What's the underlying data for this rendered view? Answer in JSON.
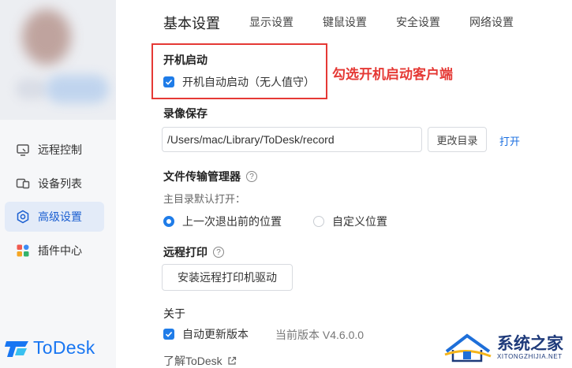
{
  "sidebar": {
    "items": [
      {
        "label": "远程控制",
        "icon": "monitor-icon",
        "active": false
      },
      {
        "label": "设备列表",
        "icon": "devices-icon",
        "active": false
      },
      {
        "label": "高级设置",
        "icon": "advanced-settings-icon",
        "active": true
      },
      {
        "label": "插件中心",
        "icon": "plugins-icon",
        "active": false
      }
    ],
    "logo_text": "ToDesk"
  },
  "tabs": [
    {
      "label": "基本设置",
      "active": true
    },
    {
      "label": "显示设置",
      "active": false
    },
    {
      "label": "键鼠设置",
      "active": false
    },
    {
      "label": "安全设置",
      "active": false
    },
    {
      "label": "网络设置",
      "active": false
    }
  ],
  "startup": {
    "title": "开机启动",
    "checkbox_label": "开机自动启动（无人值守）",
    "checked": true,
    "annotation": "勾选开机启动客户端"
  },
  "recording": {
    "title": "录像保存",
    "path": "/Users/mac/Library/ToDesk/record",
    "change_button": "更改目录",
    "open_link": "打开"
  },
  "file_transfer": {
    "title": "文件传输管理器",
    "help": "?",
    "sub_label": "主目录默认打开：",
    "options": [
      {
        "label": "上一次退出前的位置",
        "selected": true
      },
      {
        "label": "自定义位置",
        "selected": false
      }
    ]
  },
  "remote_print": {
    "title": "远程打印",
    "help": "?",
    "install_button": "安装远程打印机驱动"
  },
  "about": {
    "title": "关于",
    "auto_update_label": "自动更新版本",
    "auto_update_checked": true,
    "version_text": "当前版本 V4.6.0.0",
    "learn_more": "了解ToDesk"
  },
  "watermark": {
    "text": "系统之家",
    "sub": "XITONGZHIJIA.NET"
  },
  "colors": {
    "accent": "#1f7ce8",
    "annotation": "#e53935",
    "active_nav_bg": "#e3ebf8",
    "logo": "#1876f2"
  }
}
